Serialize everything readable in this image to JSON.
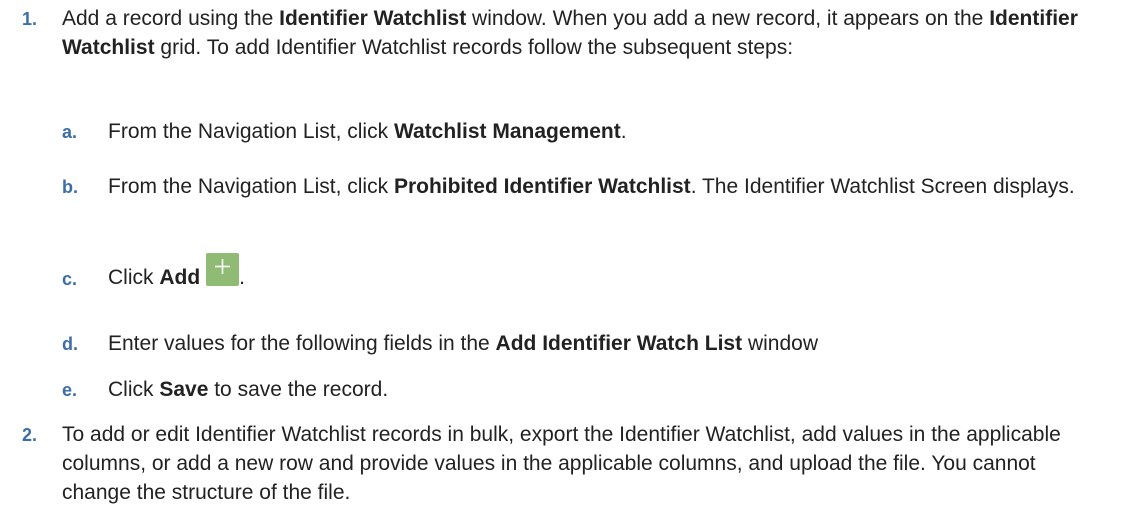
{
  "steps": [
    {
      "num": "1.",
      "parts": [
        "Add a record using the ",
        "Identifier Watchlist",
        " window. When you add a new record, it appears on the ",
        "Identifier Watchlist",
        " grid. To add Identifier Watchlist records follow the subsequent steps:"
      ],
      "substeps": [
        {
          "num": "a.",
          "parts": [
            "From the Navigation List, click ",
            "Watchlist Management",
            "."
          ]
        },
        {
          "num": "b.",
          "parts": [
            "From the Navigation List, click ",
            "Prohibited Identifier Watchlist",
            ". The Identifier Watchlist Screen displays."
          ]
        },
        {
          "num": "c.",
          "parts": [
            "Click ",
            "Add",
            "."
          ],
          "icon": "plus-icon"
        },
        {
          "num": "d.",
          "parts": [
            "Enter values for the following fields in the ",
            "Add Identifier Watch List",
            " window"
          ]
        },
        {
          "num": "e.",
          "parts": [
            "Click ",
            "Save",
            " to save the record."
          ]
        }
      ]
    },
    {
      "num": "2.",
      "text": "To add or edit Identifier Watchlist records in bulk, export the Identifier Watchlist, add values in the applicable columns, or add a new row and provide values in the applicable columns, and upload the file. You cannot change the structure of the file."
    }
  ],
  "colors": {
    "number": "#3c6ea5",
    "text": "#222222",
    "add_icon_bg": "#8fbb74"
  }
}
